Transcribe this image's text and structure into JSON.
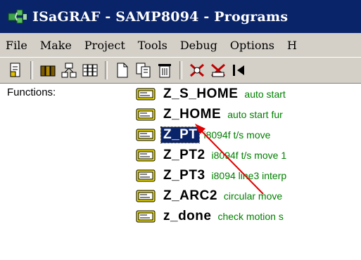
{
  "window": {
    "title": "ISaGRAF - SAMP8094 - Programs",
    "icon": "isagraf-app-icon"
  },
  "menu": [
    "File",
    "Make",
    "Project",
    "Tools",
    "Debug",
    "Options",
    "H"
  ],
  "toolbar": {
    "buttons": [
      "document-properties-icon",
      "library-icon",
      "connect-icon",
      "variables-icon",
      "new-program-icon",
      "copy-program-icon",
      "delete-program-icon",
      "compile-icon",
      "verify-icon",
      "run-icon"
    ]
  },
  "list": {
    "section_label": "Functions:",
    "items": [
      {
        "name": "Z_S_HOME",
        "desc": "auto start"
      },
      {
        "name": "Z_HOME",
        "desc": "auto start fur"
      },
      {
        "name": "Z_PT",
        "desc": "i8094f t/s move"
      },
      {
        "name": "Z_PT2",
        "desc": "i8094f t/s move 1"
      },
      {
        "name": "Z_PT3",
        "desc": "i8094 line3 interp"
      },
      {
        "name": "Z_ARC2",
        "desc": "circular move"
      },
      {
        "name": "z_done",
        "desc": "check motion s"
      }
    ],
    "selected_index": 2
  },
  "colors": {
    "titlebar": "#0a246a",
    "chrome": "#d4d0c8",
    "description_text": "#008000",
    "annotation_arrow": "#e00000"
  }
}
